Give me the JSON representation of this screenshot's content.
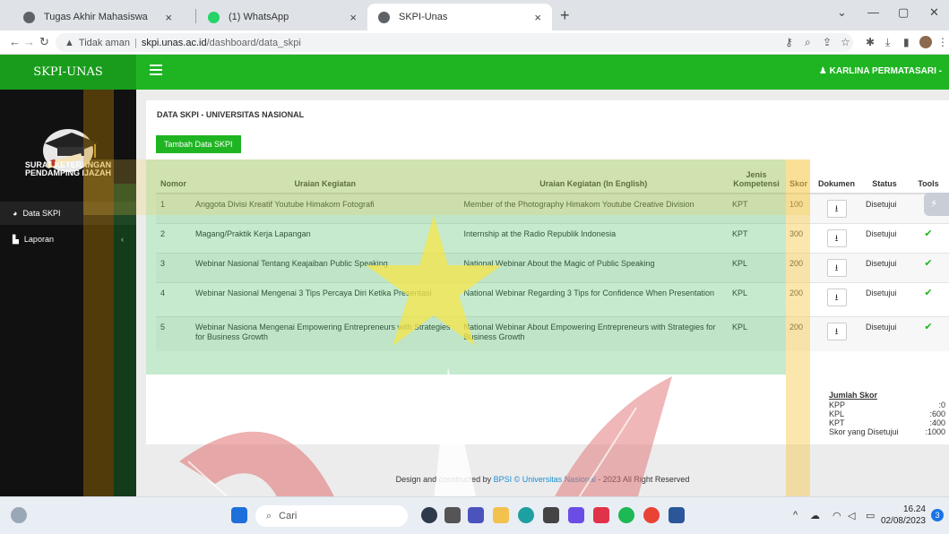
{
  "browser": {
    "tabs": [
      {
        "title": "Tugas Akhir Mahasiswa",
        "icon": "globe-icon"
      },
      {
        "title": "(1) WhatsApp",
        "icon": "whatsapp-icon"
      },
      {
        "title": "SKPI-Unas",
        "icon": "globe-icon"
      }
    ],
    "close_glyph": "×",
    "new_tab_glyph": "+",
    "security_label": "Tidak aman",
    "url_host": "skpi.unas.ac.id",
    "url_path": "/dashboard/data_skpi"
  },
  "app": {
    "brand": "SKPI-UNAS",
    "user_name": "KARLINA PERMATASARI -",
    "accent_color": "#1fb522"
  },
  "sidebar": {
    "title_line1": "SURAT KETERANGAN",
    "title_line2": "PENDAMPING IJAZAH",
    "items": [
      {
        "label": "Data SKPI",
        "icon": "dashboard-icon"
      },
      {
        "label": "Laporan",
        "icon": "file-icon",
        "chevron": "‹"
      }
    ]
  },
  "main": {
    "title": "DATA SKPI - UNIVERSITAS NASIONAL",
    "add_button": "Tambah Data SKPI",
    "columns": {
      "nomor": "Nomor",
      "uraian": "Uraian Kegiatan",
      "uraian_en": "Uraian Kegiatan (In English)",
      "jenis_line1": "Jenis",
      "jenis_line2": "Kompetensi",
      "skor": "Skor",
      "dokumen": "Dokumen",
      "status": "Status",
      "tools": "Tools"
    },
    "rows": [
      {
        "no": "1",
        "uraian": "Anggota Divisi Kreatif Youtube Himakom Fotografi",
        "uraian_en": "Member of the Photography Himakom Youtube Creative Division",
        "jenis": "KPT",
        "skor": "100",
        "status": "Disetujui"
      },
      {
        "no": "2",
        "uraian": "Magang/Praktik Kerja Lapangan",
        "uraian_en": "Internship at the Radio Republik Indonesia",
        "jenis": "KPT",
        "skor": "300",
        "status": "Disetujui"
      },
      {
        "no": "3",
        "uraian": "Webinar Nasional Tentang Keajaiban Public Speaking",
        "uraian_en": "National Webinar About the Magic of Public Speaking",
        "jenis": "KPL",
        "skor": "200",
        "status": "Disetujui"
      },
      {
        "no": "4",
        "uraian": "Webinar Nasional Mengenai 3 Tips Percaya Diri Ketika Presentasi",
        "uraian_en": "National Webinar Regarding 3 Tips for Confidence When Presentation",
        "jenis": "KPL",
        "skor": "200",
        "status": "Disetujui"
      },
      {
        "no": "5",
        "uraian": "Webinar Nasiona Mengenai Empowering Entrepreneurs with Strategies for Business Growth",
        "uraian_en": "National Webinar About Empowering Entrepreneurs with Strategies for Business Growth",
        "jenis": "KPL",
        "skor": "200",
        "status": "Disetujui"
      }
    ],
    "download_glyph": "⭳",
    "check_glyph": "✔",
    "summary": {
      "title": "Jumlah Skor",
      "items": [
        {
          "label": "KPP",
          "value": ":0"
        },
        {
          "label": "KPL",
          "value": ":600"
        },
        {
          "label": "KPT",
          "value": ":400"
        },
        {
          "label": "Skor yang Disetujui",
          "value": ":1000"
        }
      ]
    },
    "footer_pre": "Design and constructed by ",
    "footer_hl": "BPSI © Universitas Nasional",
    "footer_post": " - 2023 All Right Reserved"
  },
  "taskbar": {
    "search_placeholder": "Cari",
    "time": "16.24",
    "date": "02/08/2023",
    "notification_count": "3"
  }
}
